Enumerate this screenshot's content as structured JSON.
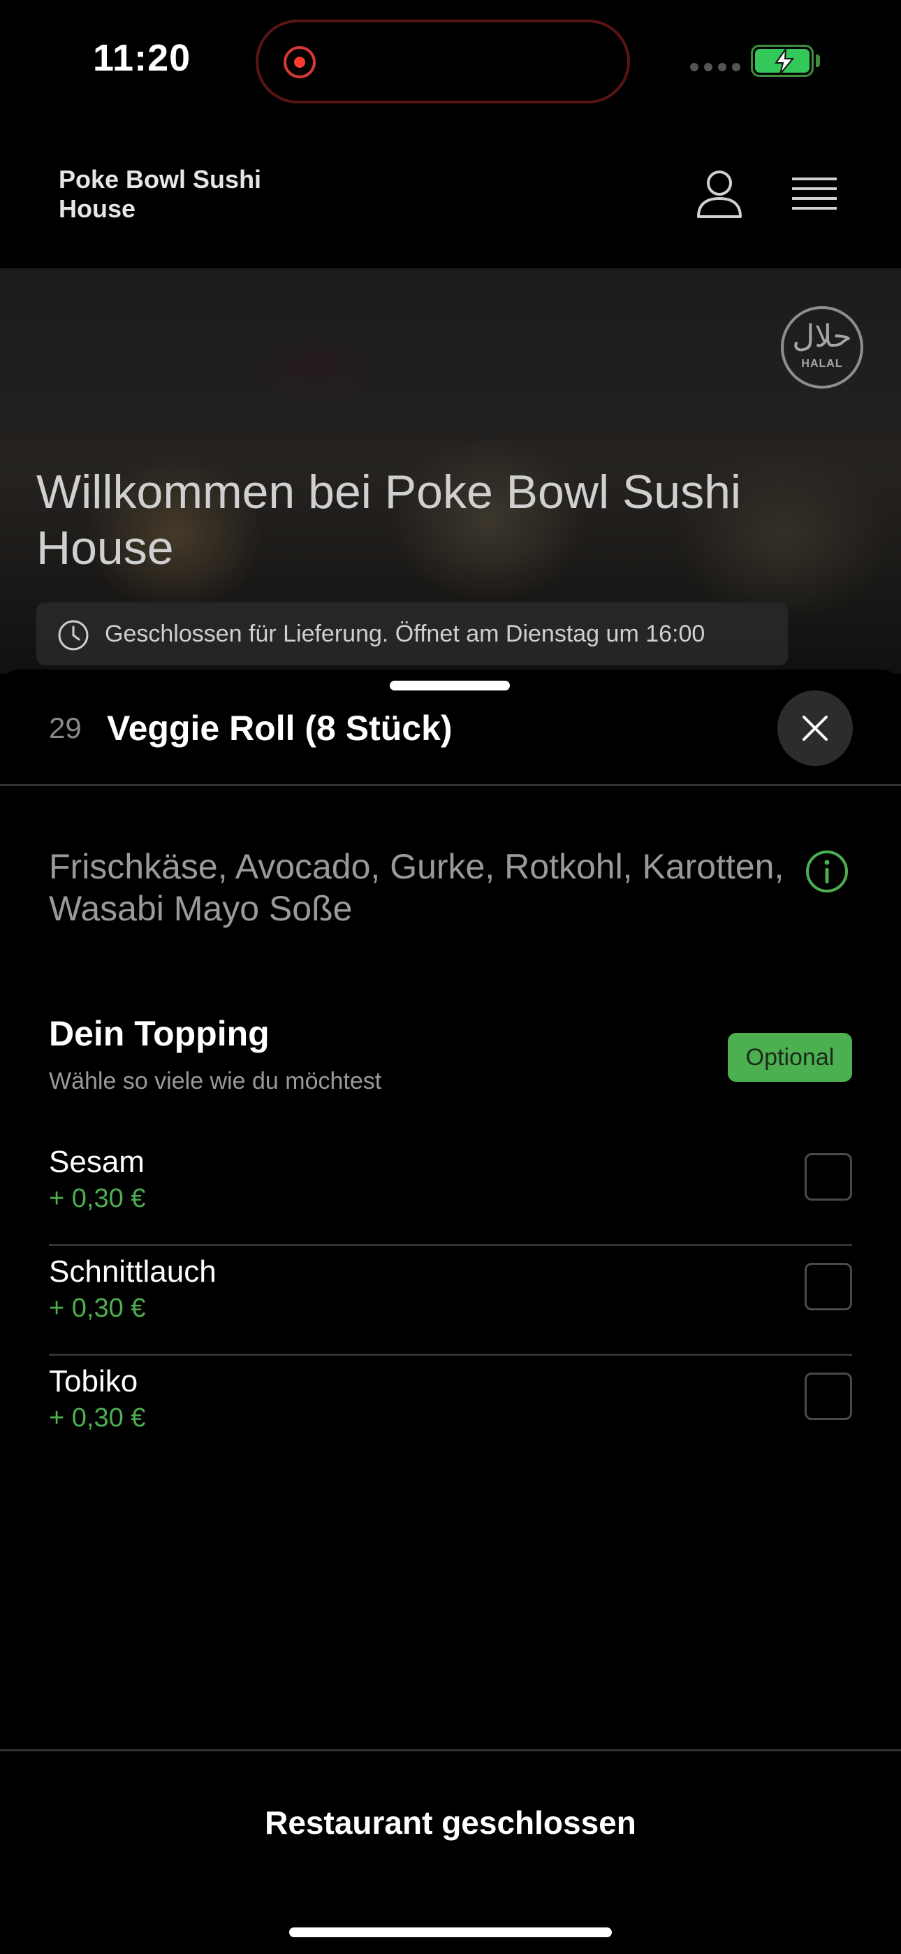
{
  "status_bar": {
    "time": "11:20"
  },
  "header": {
    "restaurant_name": "Poke Bowl Sushi House",
    "account_icon": "person-icon",
    "menu_icon": "hamburger-menu-icon"
  },
  "hero": {
    "badge_arabic": "حلال",
    "badge_label": "HALAL",
    "title": "Willkommen bei Poke Bowl Sushi House",
    "closed_notice": "Geschlossen für Lieferung. Öffnet am Dienstag um 16:00"
  },
  "item": {
    "number": "29",
    "title": "Veggie Roll (8 Stück)",
    "description": "Frischkäse, Avocado, Gurke, Rotkohl, Karotten, Wasabi Mayo Soße"
  },
  "topping_section": {
    "title": "Dein Topping",
    "subtitle": "Wähle so viele wie du möchtest",
    "badge": "Optional",
    "options": [
      {
        "name": "Sesam",
        "price": "+ 0,30 €",
        "checked": false
      },
      {
        "name": "Schnittlauch",
        "price": "+ 0,30 €",
        "checked": false
      },
      {
        "name": "Tobiko",
        "price": "+ 0,30 €",
        "checked": false
      }
    ]
  },
  "footer": {
    "button_label": "Restaurant geschlossen"
  },
  "colors": {
    "accent_green": "#4caf50",
    "background": "#000000",
    "recording_red": "#ff3b30"
  }
}
